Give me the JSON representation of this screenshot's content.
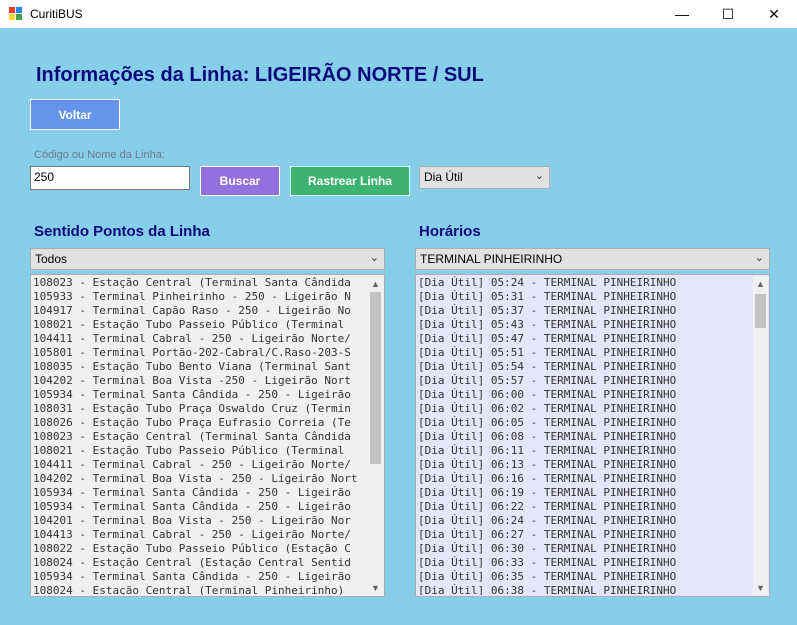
{
  "window": {
    "title": "CuritiBUS",
    "minimize": "—",
    "maximize": "☐",
    "close": "✕"
  },
  "header": {
    "title": "Informações da Linha: LIGEIRÃO NORTE / SUL"
  },
  "buttons": {
    "back": "Voltar",
    "search": "Buscar",
    "track": "Rastrear Linha"
  },
  "search": {
    "label": "Código ou Nome da Linha:",
    "value": "250"
  },
  "day_select": {
    "value": "Dia Útil"
  },
  "stops": {
    "title": "Sentido Pontos da Linha",
    "direction": "Todos",
    "items": [
      "108023 - Estação Central (Terminal Santa Cândida",
      "105933 - Terminal Pinheirinho - 250 - Ligeirão N",
      "104917 - Terminal Capão Raso - 250 - Ligeirão No",
      "108021 - Estação Tubo Passeio Público (Terminal",
      "104411 - Terminal Cabral - 250 - Ligeirão Norte/",
      "105801 - Terminal Portão-202-Cabral/C.Raso-203-S",
      "108035 - Estação Tubo Bento Viana (Terminal Sant",
      "104202 - Terminal Boa Vista -250 - Ligeirão Nort",
      "105934 - Terminal Santa Cândida - 250 - Ligeirão",
      "108031 - Estação Tubo Praça Oswaldo Cruz (Termin",
      "108026 - Estação Tubo Praça Eufrasio Correia (Te",
      "108023 - Estação Central (Terminal Santa Cândida",
      "108021 - Estação Tubo Passeio Público (Terminal",
      "104411 - Terminal Cabral - 250 - Ligeirão Norte/",
      "104202 - Terminal Boa Vista - 250 - Ligeirão Nort",
      "105934 - Terminal Santa Cândida - 250 - Ligeirão",
      "105934 - Terminal Santa Cândida - 250 - Ligeirão",
      "104201 - Terminal Boa Vista - 250 - Ligeirão Nor",
      "104413 - Terminal Cabral - 250 - Ligeirão Norte/",
      "108022 - Estação Tubo Passeio Público (Estação C",
      "108024 - Estação Central (Estação Central Sentid",
      "105934 - Terminal Santa Cândida - 250 - Ligeirão",
      "108024 - Estação Central (Terminal Pinheirinho)"
    ]
  },
  "schedule": {
    "title": "Horários",
    "terminal": "TERMINAL PINHEIRINHO",
    "items": [
      "[Dia Útil] 05:24 - TERMINAL PINHEIRINHO",
      "[Dia Útil] 05:31 - TERMINAL PINHEIRINHO",
      "[Dia Útil] 05:37 - TERMINAL PINHEIRINHO",
      "[Dia Útil] 05:43 - TERMINAL PINHEIRINHO",
      "[Dia Útil] 05:47 - TERMINAL PINHEIRINHO",
      "[Dia Útil] 05:51 - TERMINAL PINHEIRINHO",
      "[Dia Útil] 05:54 - TERMINAL PINHEIRINHO",
      "[Dia Útil] 05:57 - TERMINAL PINHEIRINHO",
      "[Dia Útil] 06:00 - TERMINAL PINHEIRINHO",
      "[Dia Útil] 06:02 - TERMINAL PINHEIRINHO",
      "[Dia Útil] 06:05 - TERMINAL PINHEIRINHO",
      "[Dia Útil] 06:08 - TERMINAL PINHEIRINHO",
      "[Dia Útil] 06:11 - TERMINAL PINHEIRINHO",
      "[Dia Útil] 06:13 - TERMINAL PINHEIRINHO",
      "[Dia Útil] 06:16 - TERMINAL PINHEIRINHO",
      "[Dia Útil] 06:19 - TERMINAL PINHEIRINHO",
      "[Dia Útil] 06:22 - TERMINAL PINHEIRINHO",
      "[Dia Útil] 06:24 - TERMINAL PINHEIRINHO",
      "[Dia Útil] 06:27 - TERMINAL PINHEIRINHO",
      "[Dia Útil] 06:30 - TERMINAL PINHEIRINHO",
      "[Dia Útil] 06:33 - TERMINAL PINHEIRINHO",
      "[Dia Útil] 06:35 - TERMINAL PINHEIRINHO",
      "[Dia Útil] 06:38 - TERMINAL PINHEIRINHO"
    ]
  },
  "colors": {
    "background": "#87ceeb",
    "title": "#0a0a7a",
    "back_button": "#6495ed",
    "search_button": "#9370db",
    "track_button": "#3cb371",
    "stops_list_bg": "#f0f0f0",
    "schedule_list_bg": "#e6e6fa"
  },
  "icons": {
    "app": "app-icon",
    "dropdown": "chevron-down-icon",
    "scroll_up": "chevron-up-icon",
    "scroll_down": "chevron-down-icon"
  }
}
